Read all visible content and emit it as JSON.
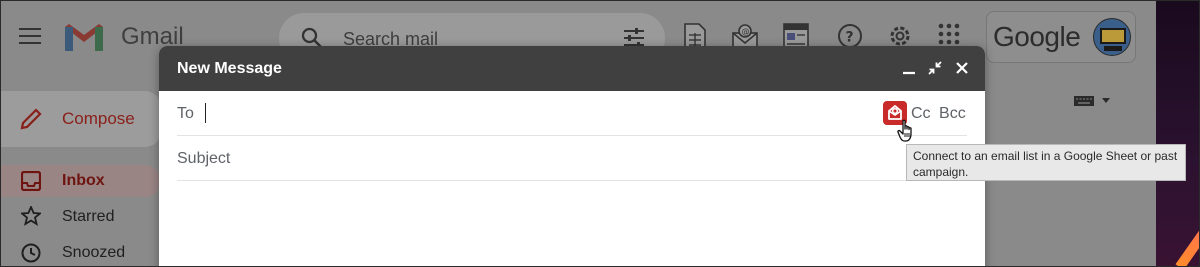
{
  "app": {
    "name": "Gmail",
    "google_wordmark": "Google"
  },
  "search": {
    "placeholder": "Search mail"
  },
  "sidebar": {
    "compose_label": "Compose",
    "items": [
      {
        "label": "Inbox",
        "icon": "inbox-icon",
        "active": true
      },
      {
        "label": "Starred",
        "icon": "star-icon",
        "active": false
      },
      {
        "label": "Snoozed",
        "icon": "clock-icon",
        "active": false
      }
    ]
  },
  "compose": {
    "title": "New Message",
    "to_label": "To",
    "cc_label": "Cc",
    "bcc_label": "Bcc",
    "subject_label": "Subject",
    "addon_tooltip": "Connect to an email list in a Google Sheet or past campaign."
  },
  "colors": {
    "header": "#404040",
    "addon": "#c92a2a",
    "compose_text": "#8a1f1a"
  }
}
